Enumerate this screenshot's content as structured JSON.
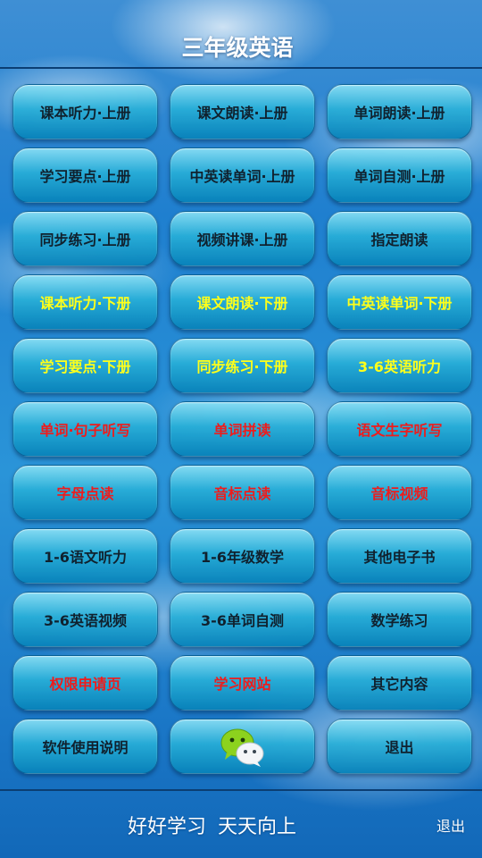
{
  "header": {
    "title": "三年级英语"
  },
  "colors": {
    "yellow": "#ffff1a",
    "red": "#ee1c1c",
    "black": "#10212e"
  },
  "menu": {
    "r1c1": "课本听力·上册",
    "r1c2": "课文朗读·上册",
    "r1c3": "单词朗读·上册",
    "r2c1": "学习要点·上册",
    "r2c2": "中英读单词·上册",
    "r2c3": "单词自测·上册",
    "r3c1": "同步练习·上册",
    "r3c2": "视频讲课·上册",
    "r3c3": "指定朗读",
    "r4c1": "课本听力·下册",
    "r4c2": "课文朗读·下册",
    "r4c3": "中英读单词·下册",
    "r5c1": "学习要点·下册",
    "r5c2": "同步练习·下册",
    "r5c3": "3-6英语听力",
    "r6c1": "单词·句子听写",
    "r6c2": "单词拼读",
    "r6c3": "语文生字听写",
    "r7c1": "字母点读",
    "r7c2": "音标点读",
    "r7c3": "音标视频",
    "r8c1": "1-6语文听力",
    "r8c2": "1-6年级数学",
    "r8c3": "其他电子书",
    "r9c1": "3-6英语视频",
    "r9c2": "3-6单词自测",
    "r9c3": "数学练习",
    "r10c1": "权限申请页",
    "r10c2": "学习网站",
    "r10c3": "其它内容",
    "r11c1": "软件使用说明",
    "r11c2_icon": "wechat-icon",
    "r11c3": "退出"
  },
  "footer": {
    "motto": "好好学习 天天向上",
    "exit_label": "退出"
  }
}
